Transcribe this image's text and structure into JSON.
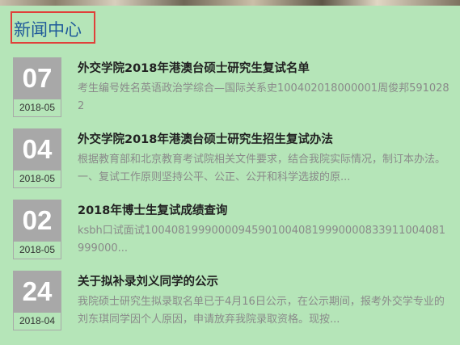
{
  "section": {
    "title": "新闻中心"
  },
  "news": [
    {
      "day": "07",
      "month": "2018-05",
      "title": "外交学院2018年港澳台硕士研究生复试名单",
      "summary": "考生编号姓名英语政治学综合—国际关系史100402018000001周俊邦5910282"
    },
    {
      "day": "04",
      "month": "2018-05",
      "title": "外交学院2018年港澳台硕士研究生招生复试办法",
      "summary": "根据教育部和北京教育考试院相关文件要求，结合我院实际情况，制订本办法。一、复试工作原则坚持公平、公正、公开和科学选拔的原..."
    },
    {
      "day": "02",
      "month": "2018-05",
      "title": "2018年博士生复试成绩查询",
      "summary": "ksbh口试面试100408199900009459010040819990000833911004081999000..."
    },
    {
      "day": "24",
      "month": "2018-04",
      "title": "关于拟补录刘义同学的公示",
      "summary": "我院硕士研究生拟录取名单已于4月16日公示，在公示期间，报考外交学专业的刘东琪同学因个人原因，申请放弃我院录取资格。现按..."
    }
  ]
}
